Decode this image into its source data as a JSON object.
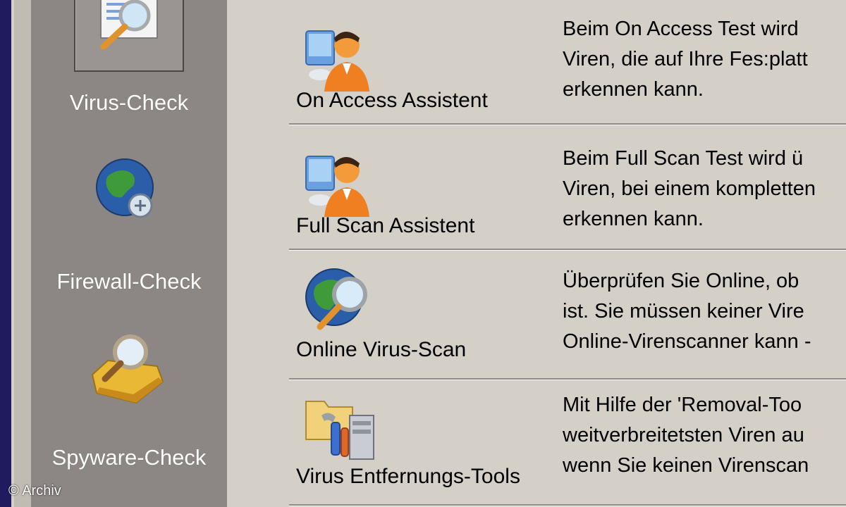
{
  "sidebar": {
    "items": [
      {
        "label": "Virus-Check",
        "icon": "document-magnifier-icon"
      },
      {
        "label": "Firewall-Check",
        "icon": "globe-network-icon"
      },
      {
        "label": "Spyware-Check",
        "icon": "folder-magnifier-icon"
      }
    ]
  },
  "main": {
    "rows": [
      {
        "title": "On Access Assistent",
        "icon": "user-computer-icon",
        "desc": [
          "Beim On Access Test wird",
          "Viren, die auf Ihre Fes:platt",
          "erkennen kann."
        ]
      },
      {
        "title": "Full Scan Assistent",
        "icon": "user-computer-icon",
        "desc": [
          "Beim Full Scan Test wird ü",
          "Viren, bei einem kompletten",
          "erkennen kann."
        ]
      },
      {
        "title": "Online Virus-Scan",
        "icon": "globe-magnifier-icon",
        "desc": [
          "Überprüfen Sie Online, ob",
          "ist. Sie müssen keiner Vire",
          "Online-Virenscanner kann -"
        ]
      },
      {
        "title": "Virus Entfernungs-Tools",
        "icon": "tools-folder-icon",
        "desc": [
          "Mit Hilfe der 'Removal-Too",
          "weitverbreitetsten Viren au",
          "wenn Sie keinen Virenscan"
        ]
      }
    ]
  },
  "copyright": "© Archiv",
  "colors": {
    "sidebar_bg": "#8c8784",
    "main_bg": "#d4d0c8",
    "edge": "#1f1b5e"
  }
}
